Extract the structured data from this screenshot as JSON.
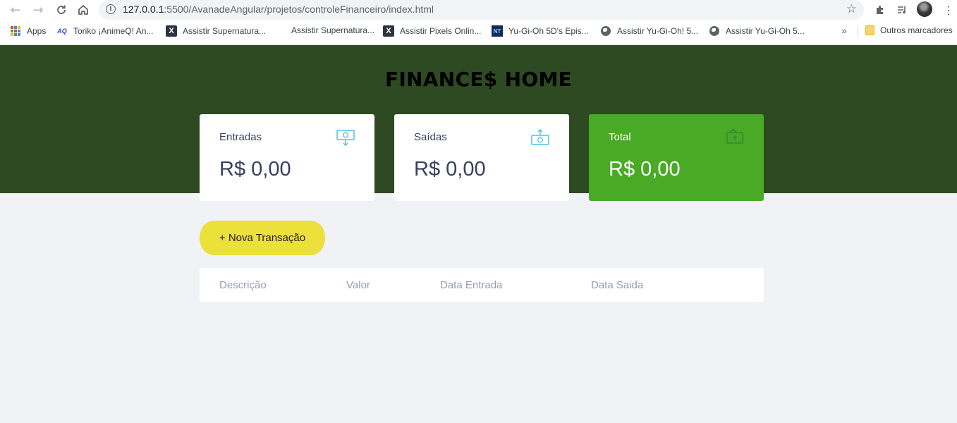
{
  "browser": {
    "url_host": "127.0.0.1",
    "url_path": ":5500/AvanadeAngular/projetos/controleFinanceiro/index.html",
    "bookmarks": [
      {
        "label": "Apps",
        "icon": "apps-grid-icon"
      },
      {
        "label": "Toriko ¡AnimeQ! An...",
        "icon": "animeq-icon"
      },
      {
        "label": "Assistir Supernatura...",
        "icon": "x-site-icon"
      },
      {
        "label": "Assistir Supernatura...",
        "icon": "none"
      },
      {
        "label": "Assistir Pixels Onlin...",
        "icon": "x-site-icon"
      },
      {
        "label": "Yu-Gi-Oh 5D's Epis...",
        "icon": "nt-icon"
      },
      {
        "label": "Assistir Yu-Gi-Oh! 5...",
        "icon": "globe-icon"
      },
      {
        "label": "Assistir Yu-Gi-Oh 5...",
        "icon": "globe-icon"
      }
    ],
    "more_label": "»",
    "other_bookmarks": "Outros marcadores"
  },
  "page": {
    "title": "FINANCE$ HOME",
    "cards": {
      "entradas": {
        "label": "Entradas",
        "value": "R$ 0,00",
        "icon": "income-money-icon"
      },
      "saidas": {
        "label": "Saídas",
        "value": "R$ 0,00",
        "icon": "expense-money-icon"
      },
      "total": {
        "label": "Total",
        "value": "R$ 0,00",
        "icon": "total-money-icon"
      }
    },
    "new_transaction_label": "+ Nova Transação",
    "table": {
      "headers": [
        "Descrição",
        "Valor",
        "Data Entrada",
        "Data Saida"
      ]
    }
  },
  "colors": {
    "hero": "#2d4a22",
    "total_card": "#49aa26",
    "button": "#ece03a",
    "background": "#f0f2f5",
    "text": "#363f5f",
    "muted": "#969cb3"
  }
}
